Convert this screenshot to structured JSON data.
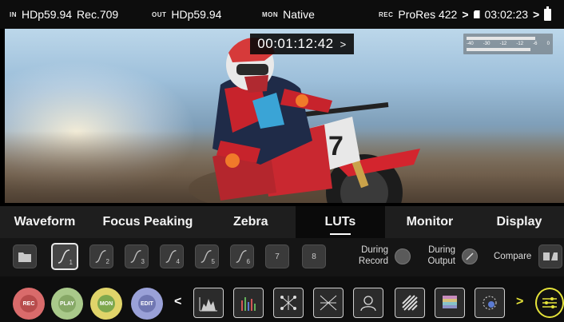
{
  "status": {
    "in_tag": "IN",
    "in_value": "HDp59.94",
    "in_gamut": "Rec.709",
    "out_tag": "OUT",
    "out_value": "HDp59.94",
    "mon_tag": "MON",
    "mon_value": "Native",
    "rec_tag": "REC",
    "rec_codec": "ProRes 422",
    "rec_arrow": ">",
    "rec_time": "03:02:23",
    "batt_arrow": ">"
  },
  "video": {
    "timecode": "00:01:12:42",
    "timecode_arrow": ">",
    "meter_scale": [
      "-40",
      "-30",
      "-12",
      "-12",
      "-6",
      "0"
    ]
  },
  "tabs": [
    {
      "label": "Waveform"
    },
    {
      "label": "Focus Peaking"
    },
    {
      "label": "Zebra"
    },
    {
      "label": "LUTs",
      "active": true
    },
    {
      "label": "Monitor"
    },
    {
      "label": "Display"
    }
  ],
  "luts": {
    "slots": [
      "1",
      "2",
      "3",
      "4",
      "5",
      "6",
      "7",
      "8"
    ],
    "during_record": "During\nRecord",
    "during_output": "During\nOutput",
    "compare": "Compare"
  },
  "toolbar": {
    "modes": [
      {
        "label": "REC",
        "color": "#d96b6b"
      },
      {
        "label": "PLAY",
        "color": "#a9c98a"
      },
      {
        "label": "MON",
        "color": "#e0d46a"
      },
      {
        "label": "EDIT",
        "color": "#9aa1d8"
      }
    ],
    "prev_arrow": "<",
    "next_arrow": ">",
    "tools": [
      "histogram-icon",
      "audio-meters-icon",
      "network-icon",
      "crosshair-icon",
      "person-icon",
      "stripes-icon",
      "color-bars-icon",
      "dots-icon"
    ]
  },
  "colors": {
    "accent": "#e6e43a",
    "status_bg": "#0d0d0d",
    "tab_active_bg": "#0a0a0a"
  }
}
